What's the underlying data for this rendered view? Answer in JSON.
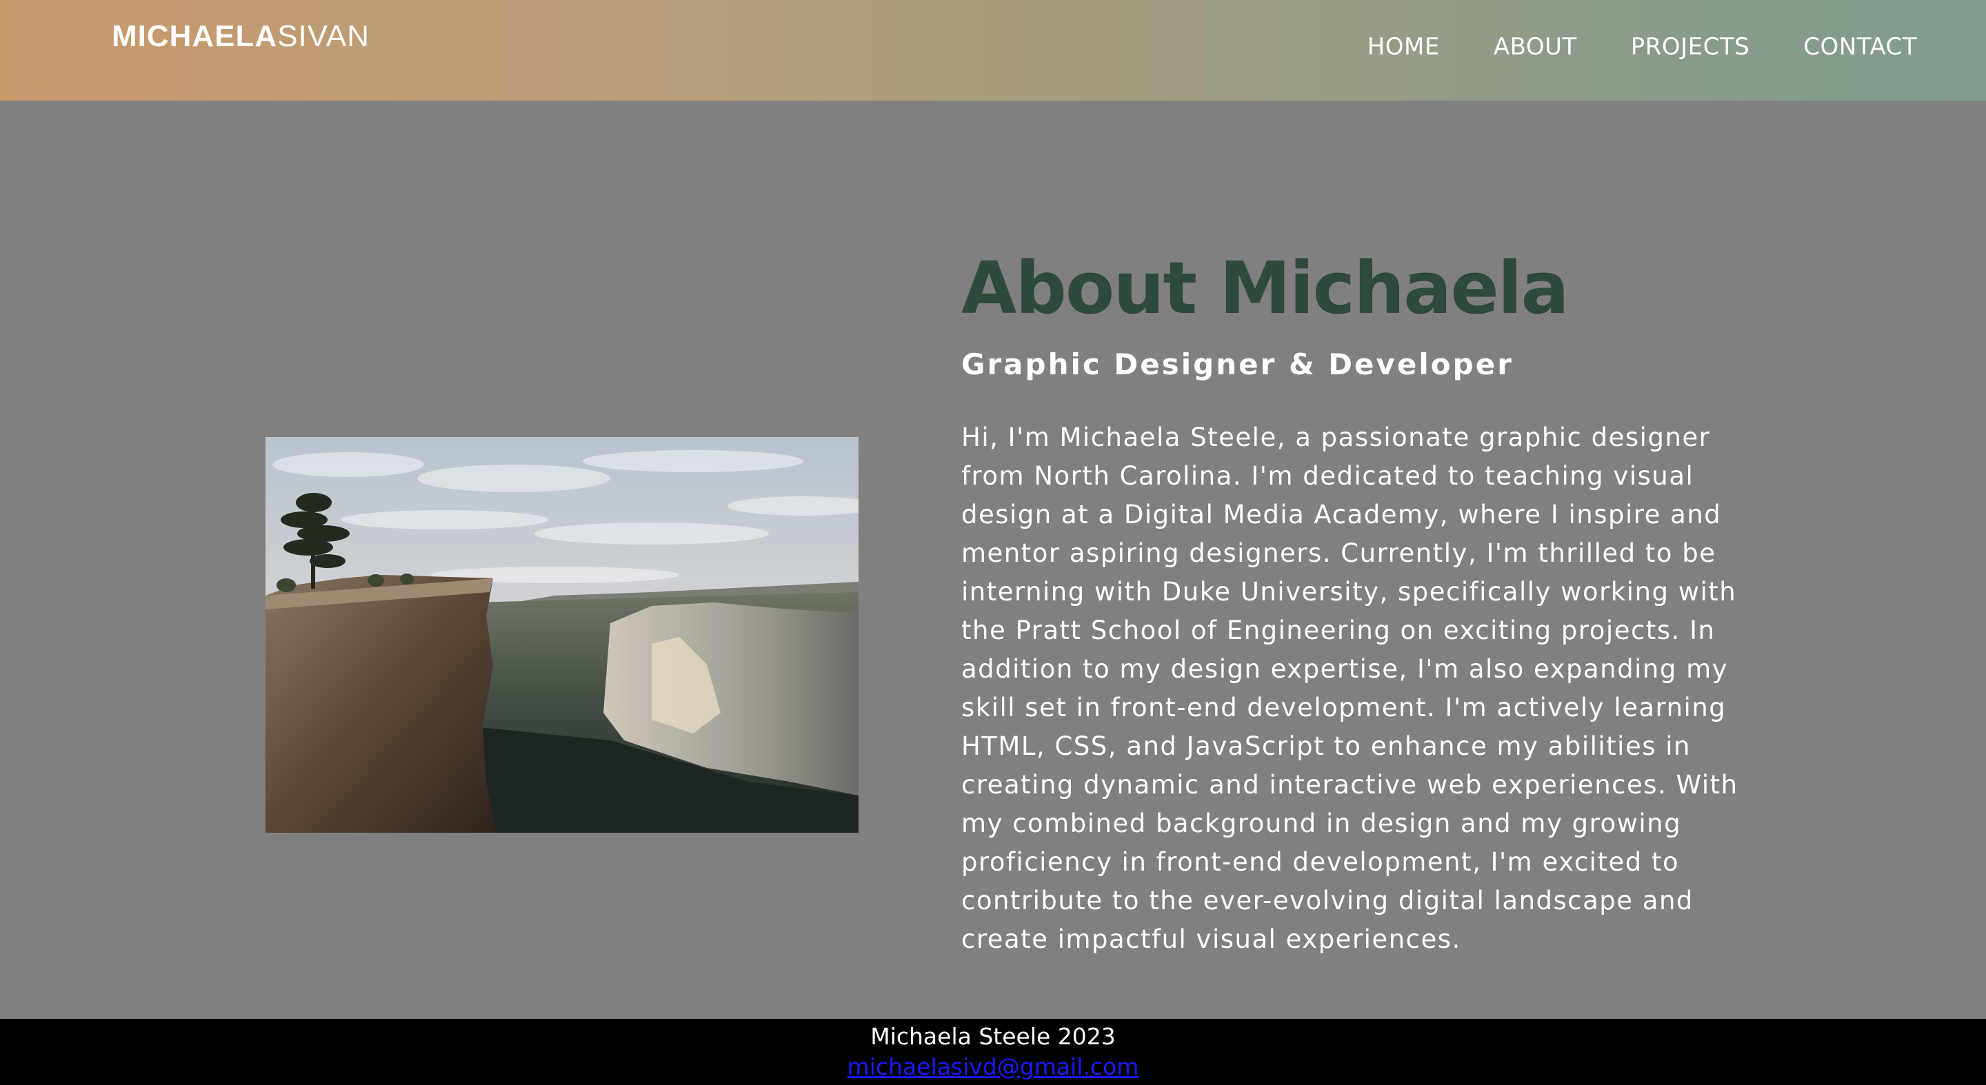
{
  "header": {
    "logo_bold": "MICHAELA",
    "logo_light": "SIVAN",
    "nav": [
      {
        "label": "HOME"
      },
      {
        "label": "ABOUT"
      },
      {
        "label": "PROJECTS"
      },
      {
        "label": "CONTACT"
      }
    ]
  },
  "about": {
    "title": "About Michaela",
    "subtitle": "Graphic Designer & Developer",
    "body": "Hi, I'm Michaela Steele, a passionate graphic designer from North Carolina. I'm dedicated to teaching visual design at a Digital Media Academy, where I inspire and mentor aspiring designers. Currently, I'm thrilled to be interning with Duke University, specifically working with the Pratt School of Engineering on exciting projects. In addition to my design expertise, I'm also expanding my skill set in front-end development. I'm actively learning HTML, CSS, and JavaScript to enhance my abilities in creating dynamic and interactive web experiences. With my combined background in design and my growing proficiency in front-end development, I'm excited to contribute to the ever-evolving digital landscape and create impactful visual experiences."
  },
  "footer": {
    "copyright": "Michaela Steele 2023",
    "email": "michaelasivd@gmail.com"
  },
  "colors": {
    "header_gradient_start": "#c8996b",
    "header_gradient_end": "#7f9c8e",
    "page_background": "#808080",
    "title_color": "#2e4a3a",
    "footer_background": "#000000",
    "link_color": "#1a1aff"
  }
}
